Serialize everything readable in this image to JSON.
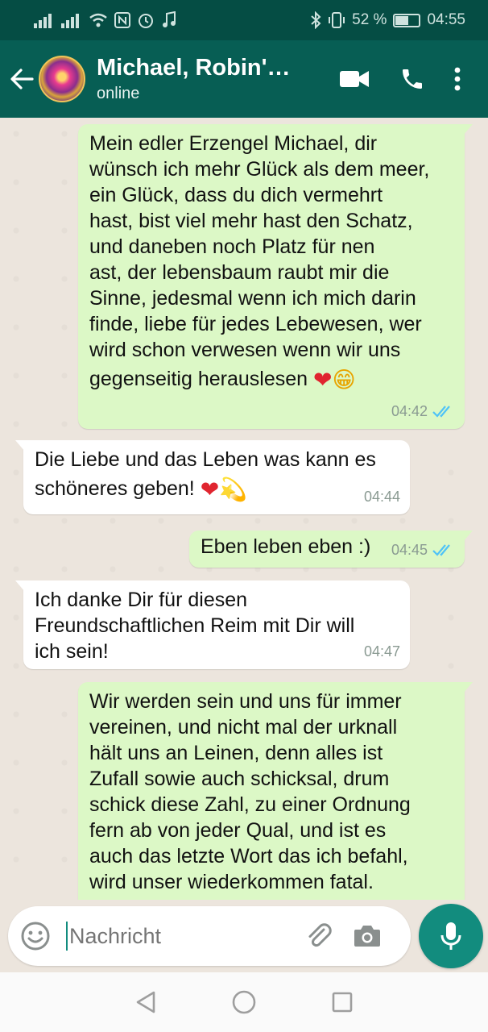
{
  "status_bar": {
    "battery": "52 %",
    "time": "04:55",
    "battery_level": 0.52
  },
  "header": {
    "contact_name": "Michael, Robin's…",
    "status": "online",
    "icons": [
      "back-arrow-icon",
      "video-call-icon",
      "phone-icon",
      "more-vert-icon"
    ]
  },
  "messages": [
    {
      "direction": "out",
      "lines": [
        "Mein edler Erzengel Michael, dir",
        "wünsch ich mehr Glück als dem meer,",
        "ein Glück, dass du dich vermehrt",
        "hast, bist viel mehr hast den Schatz,",
        "und daneben noch Platz für nen",
        "ast, der lebensbaum raubt mir die",
        "Sinne, jedesmal wenn ich mich darin",
        "finde, liebe für jedes Lebewesen, wer",
        "wird schon verwesen wenn wir uns"
      ],
      "last_line": "gegenseitig herauslesen",
      "emojis": [
        "❤",
        "😁"
      ],
      "time": "04:42",
      "read": true
    },
    {
      "direction": "in",
      "lines": [
        "Die Liebe und das Leben was kann es"
      ],
      "last_line": "schöneres geben!",
      "emojis": [
        "❤",
        "💫"
      ],
      "time": "04:44"
    },
    {
      "direction": "out",
      "text": "Eben leben eben :)",
      "time": "04:45",
      "read": true
    },
    {
      "direction": "in",
      "lines": [
        "Ich danke Dir für diesen",
        "Freundschaftlichen Reim mit Dir will",
        "ich sein!"
      ],
      "time": "04:47"
    },
    {
      "direction": "out",
      "lines": [
        "Wir werden sein und uns für immer",
        "vereinen, und nicht mal der urknall",
        "hält uns an Leinen, denn alles ist",
        "Zufall sowie auch schicksal, drum",
        "schick diese Zahl, zu einer Ordnung",
        "fern ab von jeder Qual, und ist es",
        "auch das letzte Wort das ich befahl,",
        "wird unser wiederkommen fatal."
      ]
    }
  ],
  "input": {
    "placeholder": "Nachricht"
  },
  "colors": {
    "header": "#075e54",
    "status_bar": "#054d44",
    "outgoing_bubble": "#dcf8c6",
    "incoming_bubble": "#ffffff",
    "read_ticks": "#4fc3f7",
    "accent": "#128c7e"
  }
}
